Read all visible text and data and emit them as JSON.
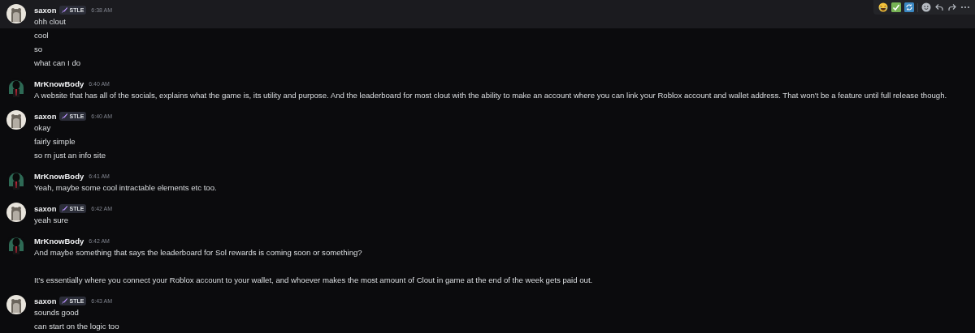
{
  "groups": [
    {
      "author": "saxon",
      "kind": "plain",
      "badge": "STLE",
      "timestamp": "6:38 AM",
      "lines": [
        {
          "text": "ohh clout",
          "hovered": true
        },
        {
          "text": "cool",
          "hovered": false
        },
        {
          "text": "so",
          "hovered": false
        },
        {
          "text": "what can I do",
          "hovered": false
        }
      ]
    },
    {
      "author": "MrKnowBody",
      "kind": "figure",
      "timestamp": "6:40 AM",
      "lines": [
        {
          "text": "A website that has all of the socials, explains what the game is, its utility and purpose. And the leaderboard for most clout with the ability to make an account where you can link your Roblox account and wallet address. That won't be a feature until full release though.",
          "hovered": false
        }
      ]
    },
    {
      "author": "saxon",
      "kind": "plain",
      "badge": "STLE",
      "timestamp": "6:40 AM",
      "lines": [
        {
          "text": "okay",
          "hovered": false
        },
        {
          "text": "fairly simple",
          "hovered": false
        },
        {
          "text": "so rn just an info site",
          "hovered": false
        }
      ]
    },
    {
      "author": "MrKnowBody",
      "kind": "figure",
      "timestamp": "6:41 AM",
      "lines": [
        {
          "text": "Yeah, maybe some cool intractable elements etc too.",
          "hovered": false
        }
      ]
    },
    {
      "author": "saxon",
      "kind": "plain",
      "badge": "STLE",
      "timestamp": "6:42 AM",
      "lines": [
        {
          "text": "yeah sure",
          "hovered": false
        }
      ]
    },
    {
      "author": "MrKnowBody",
      "kind": "figure",
      "timestamp": "6:42 AM",
      "lines": [
        {
          "text": "And maybe something that says the leaderboard for Sol rewards is coming soon or something?\n\nIt’s essentially where you connect your Roblox account to your wallet, and whoever makes the most amount of Clout in game at the end of the week gets paid out.",
          "hovered": false
        }
      ]
    },
    {
      "author": "saxon",
      "kind": "plain",
      "badge": "STLE",
      "timestamp": "6:43 AM",
      "lines": [
        {
          "text": "sounds good",
          "hovered": false
        },
        {
          "text": "can start on the logic too",
          "hovered": false
        }
      ]
    }
  ]
}
